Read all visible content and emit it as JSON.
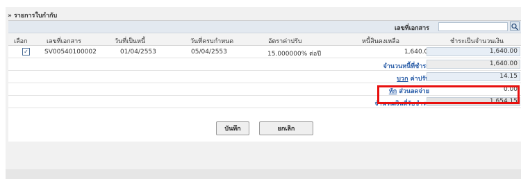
{
  "section_title": "» รายการใบกำกับ",
  "search": {
    "label": "เลขที่เอกสาร",
    "value": "",
    "button_icon": "search-icon"
  },
  "columns": [
    "เลือก",
    "เลขที่เอกสาร",
    "วันที่เป็นหนี้",
    "วันที่ครบกำหนด",
    "อัตราค่าปรับ",
    "หนี้สินคงเหลือ",
    "ชำระเป็นจำนวนเงิน"
  ],
  "row": {
    "selected": true,
    "doc_no": "SV00540100002",
    "debt_date": "01/04/2553",
    "due_date": "05/04/2553",
    "fine_rate": "15.000000% ต่อปี",
    "remaining": "1,640.00",
    "pay_amount": "1,640.00"
  },
  "summary": {
    "total_due_label": "จำนวนหนี้ที่ชำระ",
    "total_due_value": "1,640.00",
    "fine_add": "บวก",
    "fine_label": "ค่าปรับ",
    "fine_value": "14.15",
    "discount_sub": "หัก",
    "discount_label": "ส่วนลดจ่าย",
    "discount_value": "0.00",
    "net_label": "จำนวนเงินที่รับชำระ",
    "net_value": "1,654.15"
  },
  "buttons": {
    "save": "บันทึก",
    "cancel": "ยกเลิก"
  },
  "colors": {
    "highlight": "#e8100e",
    "link": "#2b5ea8",
    "input_bg": "#e7eef6"
  }
}
